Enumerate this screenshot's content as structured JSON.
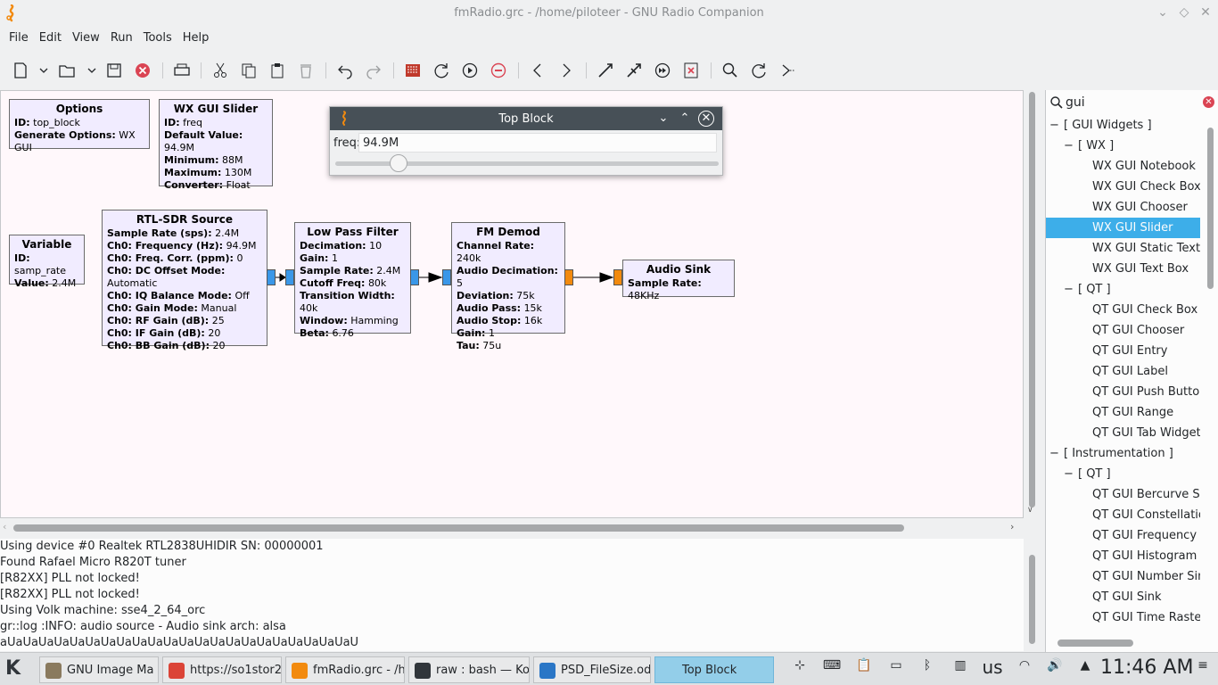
{
  "window": {
    "title": "fmRadio.grc - /home/piloteer - GNU Radio Companion"
  },
  "menu": [
    "File",
    "Edit",
    "View",
    "Run",
    "Tools",
    "Help"
  ],
  "blocks": {
    "options": {
      "title": "Options",
      "rows": [
        [
          "ID:",
          "top_block"
        ],
        [
          "Generate Options:",
          "WX GUI"
        ]
      ]
    },
    "slider": {
      "title": "WX GUI Slider",
      "rows": [
        [
          "ID:",
          "freq"
        ],
        [
          "Default Value:",
          "94.9M"
        ],
        [
          "Minimum:",
          "88M"
        ],
        [
          "Maximum:",
          "130M"
        ],
        [
          "Converter:",
          "Float"
        ]
      ]
    },
    "variable": {
      "title": "Variable",
      "rows": [
        [
          "ID:",
          "samp_rate"
        ],
        [
          "Value:",
          "2.4M"
        ]
      ]
    },
    "rtlsdr": {
      "title": "RTL-SDR Source",
      "rows": [
        [
          "Sample Rate (sps):",
          "2.4M"
        ],
        [
          "Ch0: Frequency (Hz):",
          "94.9M"
        ],
        [
          "Ch0: Freq. Corr. (ppm):",
          "0"
        ],
        [
          "Ch0: DC Offset Mode:",
          "Automatic"
        ],
        [
          "Ch0: IQ Balance Mode:",
          "Off"
        ],
        [
          "Ch0: Gain Mode:",
          "Manual"
        ],
        [
          "Ch0: RF Gain (dB):",
          "25"
        ],
        [
          "Ch0: IF Gain (dB):",
          "20"
        ],
        [
          "Ch0: BB Gain (dB):",
          "20"
        ]
      ]
    },
    "lpf": {
      "title": "Low Pass Filter",
      "rows": [
        [
          "Decimation:",
          "10"
        ],
        [
          "Gain:",
          "1"
        ],
        [
          "Sample Rate:",
          "2.4M"
        ],
        [
          "Cutoff Freq:",
          "80k"
        ],
        [
          "Transition Width:",
          "40k"
        ],
        [
          "Window:",
          "Hamming"
        ],
        [
          "Beta:",
          "6.76"
        ]
      ]
    },
    "fmdemod": {
      "title": "FM Demod",
      "rows": [
        [
          "Channel Rate:",
          "240k"
        ],
        [
          "Audio Decimation:",
          "5"
        ],
        [
          "Deviation:",
          "75k"
        ],
        [
          "Audio Pass:",
          "15k"
        ],
        [
          "Audio Stop:",
          "16k"
        ],
        [
          "Gain:",
          "1"
        ],
        [
          "Tau:",
          "75u"
        ]
      ]
    },
    "audiosink": {
      "title": "Audio Sink",
      "rows": [
        [
          "Sample Rate:",
          "48KHz"
        ]
      ]
    }
  },
  "topblock": {
    "title": "Top Block",
    "label": "freq:",
    "value": "94.9M",
    "slider_fraction": 0.165
  },
  "search": {
    "value": "gui"
  },
  "tree": [
    {
      "level": 0,
      "expander": "−",
      "label": "[ GUI Widgets ]"
    },
    {
      "level": 1,
      "expander": "−",
      "label": "[ WX ]"
    },
    {
      "level": 2,
      "label": "WX GUI Notebook"
    },
    {
      "level": 2,
      "label": "WX GUI Check Box"
    },
    {
      "level": 2,
      "label": "WX GUI Chooser"
    },
    {
      "level": 2,
      "label": "WX GUI Slider",
      "selected": true
    },
    {
      "level": 2,
      "label": "WX GUI Static Text"
    },
    {
      "level": 2,
      "label": "WX GUI Text Box"
    },
    {
      "level": 1,
      "expander": "−",
      "label": "[ QT ]"
    },
    {
      "level": 2,
      "label": "QT GUI Check Box"
    },
    {
      "level": 2,
      "label": "QT GUI Chooser"
    },
    {
      "level": 2,
      "label": "QT GUI Entry"
    },
    {
      "level": 2,
      "label": "QT GUI Label"
    },
    {
      "level": 2,
      "label": "QT GUI Push Button"
    },
    {
      "level": 2,
      "label": "QT GUI Range"
    },
    {
      "level": 2,
      "label": "QT GUI Tab Widget"
    },
    {
      "level": 0,
      "expander": "−",
      "label": "[ Instrumentation ]"
    },
    {
      "level": 1,
      "expander": "−",
      "label": "[ QT ]"
    },
    {
      "level": 2,
      "label": "QT GUI Bercurve Sin"
    },
    {
      "level": 2,
      "label": "QT GUI Constellatio"
    },
    {
      "level": 2,
      "label": "QT GUI Frequency S"
    },
    {
      "level": 2,
      "label": "QT GUI Histogram S"
    },
    {
      "level": 2,
      "label": "QT GUI Number Sink"
    },
    {
      "level": 2,
      "label": "QT GUI Sink"
    },
    {
      "level": 2,
      "label": "QT GUI Time Raster"
    }
  ],
  "console": [
    "Using device #0 Realtek RTL2838UHIDIR SN: 00000001",
    "Found Rafael Micro R820T tuner",
    "[R82XX] PLL not locked!",
    "[R82XX] PLL not locked!",
    "Using Volk machine: sse4_2_64_orc",
    "gr::log :INFO: audio source - Audio sink arch: alsa",
    "aUaUaUaUaUaUaUaUaUaUaUaUaUaUaUaUaUaUaUaUaUaUaU"
  ],
  "taskbar": {
    "tasks": [
      {
        "label": "GNU Image Ma",
        "color": "#8a7a5e"
      },
      {
        "label": "https://so1stor2",
        "color": "#db4437"
      },
      {
        "label": "fmRadio.grc - /h",
        "color": "#f28a0e"
      },
      {
        "label": "raw : bash — Ko",
        "color": "#31363b"
      },
      {
        "label": "PSD_FileSize.od",
        "color": "#2a76c6"
      },
      {
        "label": "Top Block",
        "color": "#93cee9",
        "active": true
      }
    ],
    "keyboard_layout": "us",
    "clock": "11:46 AM"
  }
}
